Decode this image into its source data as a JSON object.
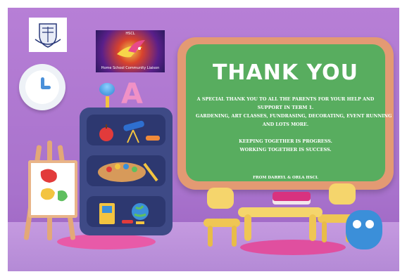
{
  "board": {
    "title": "THANK YOU",
    "lines": [
      "A SPECIAL THANK YOU TO ALL THE PARENTS FOR YOUR HELP AND",
      "SUPPORT IN TERM 1.",
      "GARDENING, ART CLASSES, FUNDRASING, DECORATING, EVENT RUNNING",
      "AND LOTS MORE.",
      "",
      "KEEPING TOGETHER IS PROGRESS.",
      "WORKING TOGETHER IS SUCCESS."
    ],
    "signature": "FROM DARRYL & ORLA HSCL"
  },
  "logos": {
    "parents_top": "HSCL",
    "parents_bottom": "Home School Community Liaison"
  },
  "colors": {
    "wall": "#a872cc",
    "board_green": "#58ad5f",
    "board_frame": "#e39a73",
    "shelf": "#3e4a86",
    "rug": "#e85aa8"
  }
}
